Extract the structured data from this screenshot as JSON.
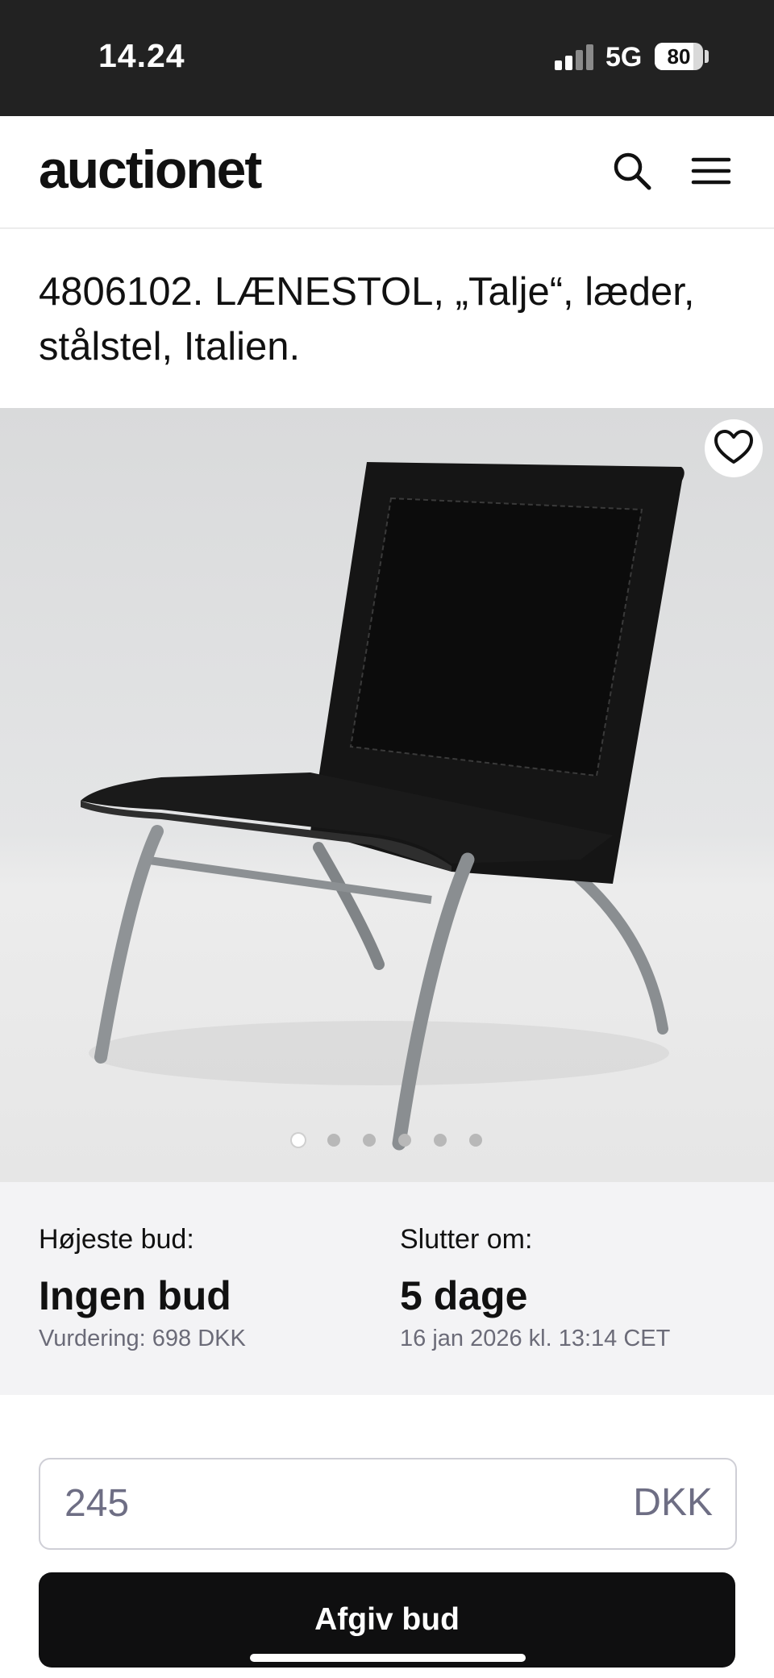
{
  "status_bar": {
    "time": "14.24",
    "network": "5G",
    "battery": "80",
    "battery_level": 0.8
  },
  "header": {
    "logo_text": "auctionet"
  },
  "lot": {
    "title": "4806102. LÆNESTOL, „Talje“, læder, stålstel, Italien."
  },
  "gallery": {
    "image_count": 6,
    "current_index": 0
  },
  "bidding": {
    "highest_bid_label": "Højeste bud:",
    "highest_bid_value": "Ingen bud",
    "estimate": "Vurdering: 698 DKK",
    "ends_label": "Slutter om:",
    "ends_value": "5 dage",
    "ends_date": "16 jan 2026 kl. 13:14 CET",
    "input_value": "245",
    "currency": "DKK",
    "submit_label": "Afgiv bud"
  }
}
